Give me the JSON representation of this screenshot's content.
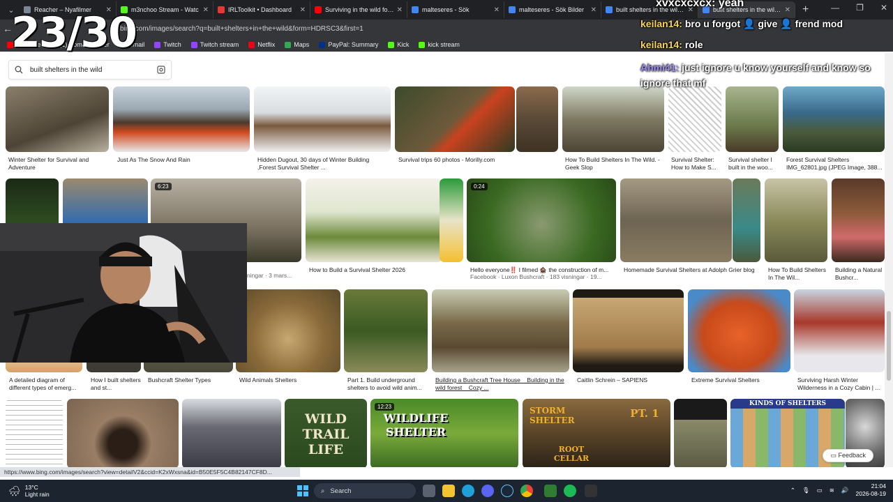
{
  "overlay": {
    "counter": "23/30"
  },
  "tabs": [
    {
      "label": "Reacher – Nyafilmer",
      "color": "#7b8794"
    },
    {
      "label": "m3nchoo Stream - Watc",
      "color": "#53fc18"
    },
    {
      "label": "IRLToolkit • Dashboard",
      "color": "#e53935"
    },
    {
      "label": "Surviving in the wild for 24 h",
      "color": "#ff0000"
    },
    {
      "label": "malteseres - Sök",
      "color": "#4285f4"
    },
    {
      "label": "malteseres - Sök Bilder",
      "color": "#4285f4"
    },
    {
      "label": "built shelters in the wild - Sö",
      "color": "#4285f4"
    },
    {
      "label": "built shelters in the wild - Sö",
      "color": "#4285f4",
      "active": true
    }
  ],
  "browser": {
    "url": "bing.com/images/search?q=built+shelters+in+the+wild&form=HDRSC3&first=1",
    "status_url": "https://www.bing.com/images/search?view=detailV2&ccid=K2xWxsna&id=B50E5F5C4B82147CF8D..."
  },
  "bookmarks": [
    {
      "label": "YouTube",
      "color": "#ff0000"
    },
    {
      "label": "(1) Home / Twitter",
      "color": "#1da1f2"
    },
    {
      "label": "Gmail",
      "color": "#ea4335"
    },
    {
      "label": "Twitch",
      "color": "#9146ff"
    },
    {
      "label": "Twitch stream",
      "color": "#9146ff"
    },
    {
      "label": "Netflix",
      "color": "#e50914"
    },
    {
      "label": "Maps",
      "color": "#34a853"
    },
    {
      "label": "PayPal: Summary",
      "color": "#003087"
    },
    {
      "label": "Kick",
      "color": "#53fc18"
    },
    {
      "label": "kick stream",
      "color": "#53fc18"
    }
  ],
  "search": {
    "query": "built shelters in the wild"
  },
  "results": {
    "row1": [
      "Winter Shelter for Survival and Adventure",
      "Just As The Snow And Rain",
      "Hidden Dugout, 30 days of Winter Building ,Forest Survival Shelter ...",
      "Survival trips 60 photos - Morilly.com",
      "How To Build Shelters In The Wild. - Geek Slop",
      "Survival Shelter: How to Make S...",
      "Survival shelter I built in the woo...",
      "Forest Survival Shelters IMG_62801.jpg (JPEG Image, 388..."
    ],
    "row2": [
      "ningar · 3 mars...",
      "How to Build a Survival Shelter 2026",
      "Hello everyone‼️ I filmed 🏚️ the construction of m...",
      "Facebook · Luxon Bushcraft · 183 visningar · 19...",
      "Homemade Survival Shelters at Adolph Grier blog",
      "How To Build Shelters In The Wil...",
      "Building a Natural Bushcr..."
    ],
    "row2_badges": [
      "6:23",
      "0:24"
    ],
    "row3": [
      "A detailed diagram of different types of emerg...",
      "How I built shelters and st...",
      "Bushcraft Shelter Types",
      "Wild Animals Shelters",
      "Part 1. Build underground shelters to avoid wild anim...",
      "Building a Bushcraft Tree House _ Building in the wild forest _ Cozy ...",
      "Caitlin Schrein – SAPIENS",
      "Extreme Survival Shelters",
      "Surviving Harsh Winter Wilderness in a Cozy Cabin | ..."
    ],
    "row4_badge": "12:23",
    "row4_texts": {
      "wild_trail": "WILD TRAIL LIFE",
      "wildlife": "WILDLIFE SHELTER",
      "storm": "STORM SHELTER",
      "root": "ROOT CELLAR",
      "pt": "PT. 1",
      "kinds": "KINDS OF SHELTERS"
    }
  },
  "feedback_label": "Feedback",
  "chat": [
    {
      "user": "keilan14:",
      "msg": "bro u forgot 👤 give 👤 frend mod"
    },
    {
      "user": "keilan14:",
      "msg": "role"
    },
    {
      "user": "Ahmi41:",
      "msg": "just ignore u know yourself and know so ignore that mf"
    },
    {
      "user": "",
      "msg": "xvxcxcxcx: yeah"
    }
  ],
  "taskbar": {
    "temp": "13°C",
    "weather": "Light rain",
    "search": "Search",
    "time": "21:04",
    "date": "2026-08-19"
  }
}
